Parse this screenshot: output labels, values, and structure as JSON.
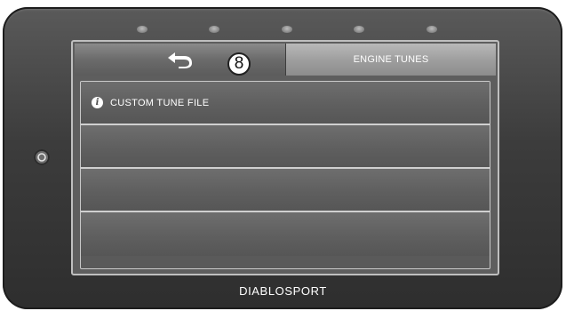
{
  "device": {
    "brand": "DIABLOSPORT",
    "leds": 5
  },
  "header": {
    "back_icon": "back-arrow-icon",
    "title": "ENGINE TUNES"
  },
  "list": {
    "items": [
      {
        "icon": "info-icon",
        "label": "CUSTOM TUNE FILE"
      },
      {
        "label": ""
      },
      {
        "label": ""
      },
      {
        "label": ""
      }
    ]
  },
  "annotation": {
    "callout_number": "8"
  },
  "colors": {
    "bezel": "#3c3c3c",
    "screen": "#5e5e5e",
    "divider": "#cfcfcf",
    "text": "#ffffff"
  }
}
